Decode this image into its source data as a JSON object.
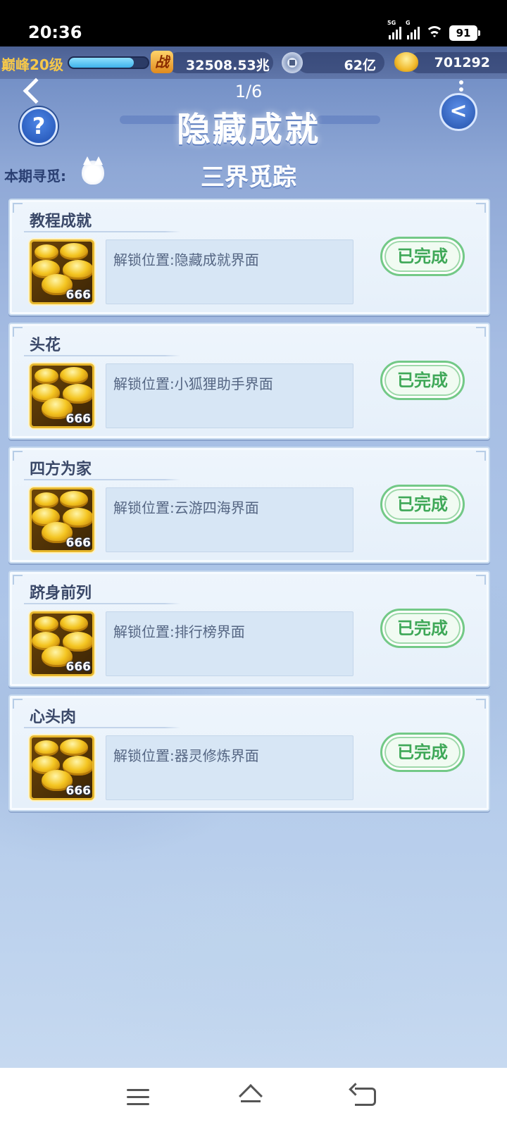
{
  "status_bar": {
    "time": "20:36",
    "signal_1_tag": "5G",
    "signal_2_tag": "G",
    "battery": "91"
  },
  "resource_bar": {
    "level_label": "巅峰20级",
    "xp_progress": 0.82,
    "power_icon_glyph": "战",
    "power_value": "32508.53兆",
    "coin_value": "62亿",
    "gold_value": "701292"
  },
  "header": {
    "page_indicator": "1/6",
    "title": "隐藏成就",
    "help_glyph": "?",
    "share_glyph": "<",
    "period_label": "本期寻觅:",
    "subtitle": "三界觅踪"
  },
  "achievements": [
    {
      "title": "教程成就",
      "reward_count": "666",
      "unlock": "解锁位置:隐藏成就界面",
      "status": "已完成"
    },
    {
      "title": "头花",
      "reward_count": "666",
      "unlock": "解锁位置:小狐狸助手界面",
      "status": "已完成"
    },
    {
      "title": "四方为家",
      "reward_count": "666",
      "unlock": "解锁位置:云游四海界面",
      "status": "已完成"
    },
    {
      "title": "跻身前列",
      "reward_count": "666",
      "unlock": "解锁位置:排行榜界面",
      "status": "已完成"
    },
    {
      "title": "心头肉",
      "reward_count": "666",
      "unlock": "解锁位置:器灵修炼界面",
      "status": "已完成"
    }
  ],
  "colors": {
    "accent_blue": "#2451a9",
    "gold": "#f4c521",
    "done_green": "#3fa858"
  },
  "icons": {
    "reward": "gold-ingot-icon",
    "help": "help-icon",
    "share": "share-icon",
    "back": "back-arrow-icon",
    "period": "fox-icon"
  }
}
